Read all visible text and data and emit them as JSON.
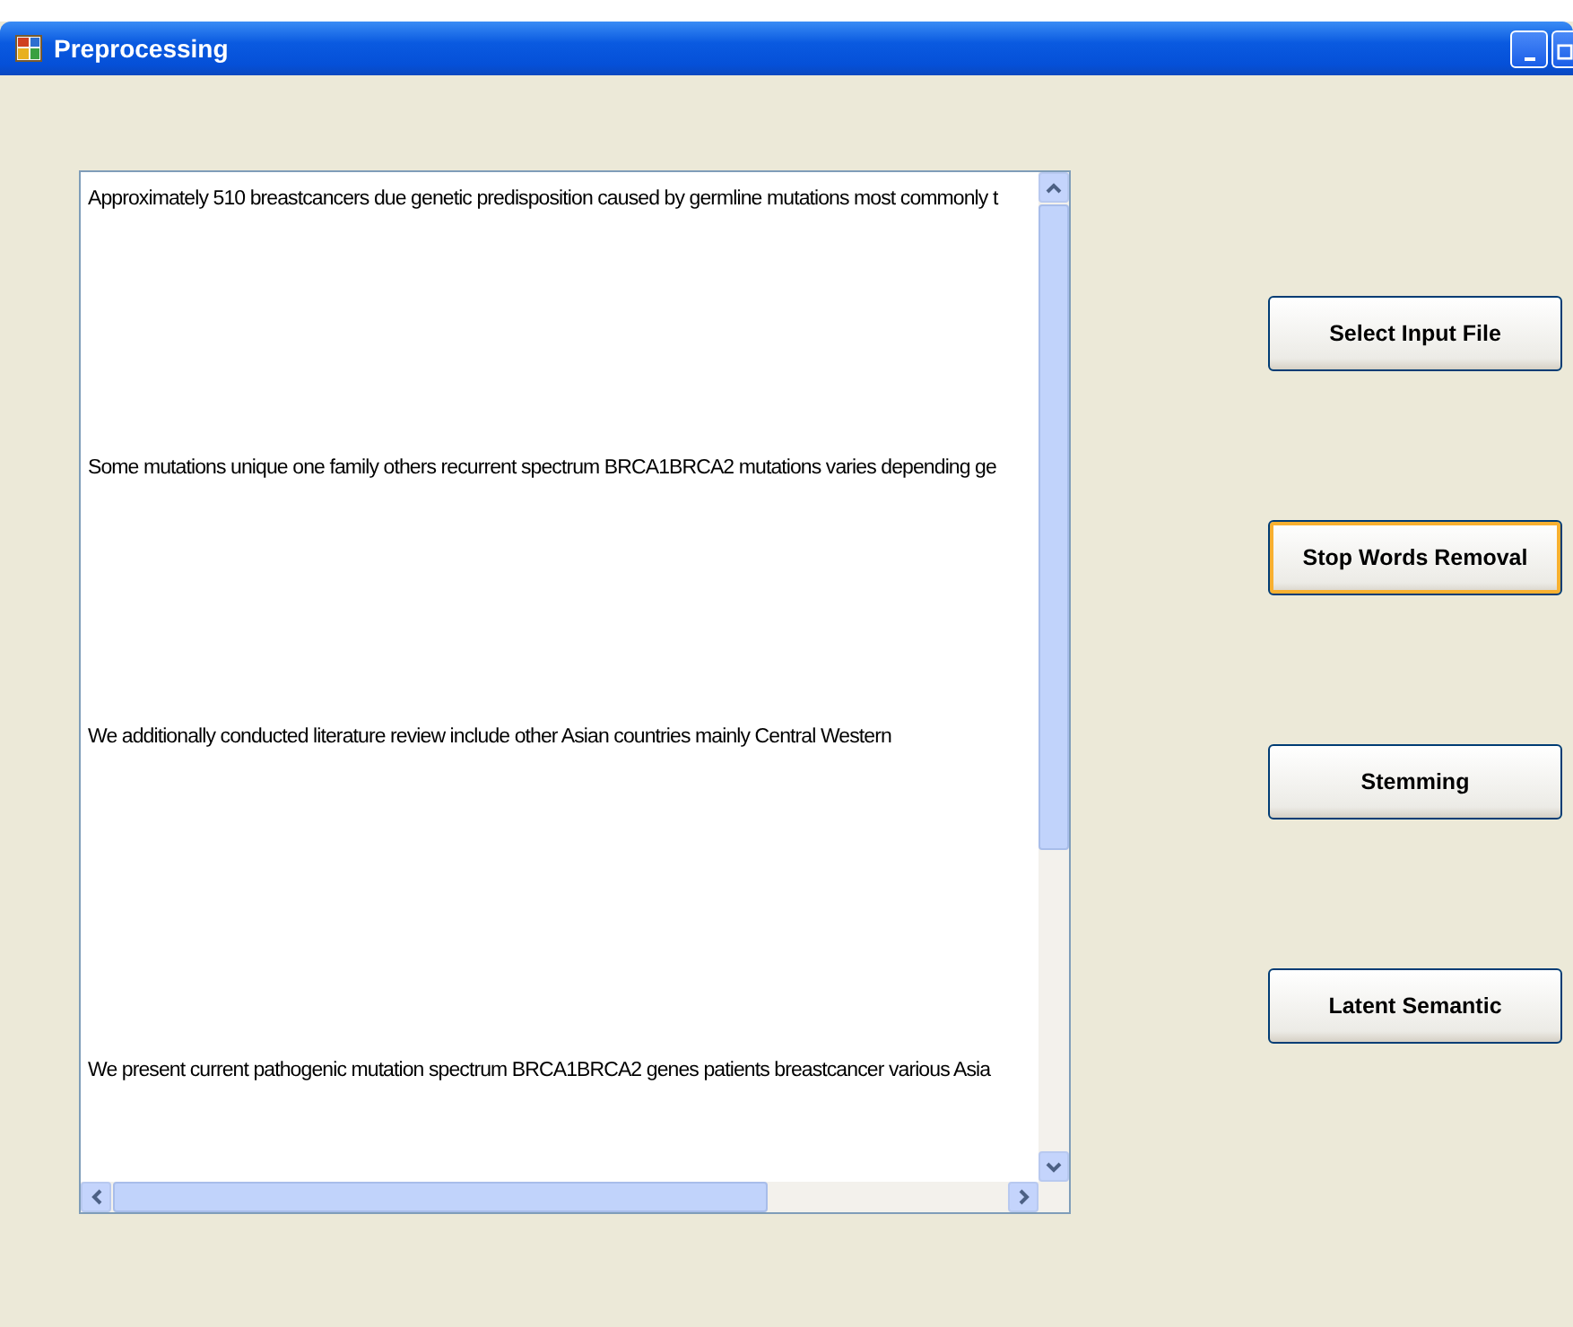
{
  "window": {
    "title": "Preprocessing"
  },
  "text_box": {
    "lines": [
      "Approximately 510 breastcancers due genetic predisposition caused by germline mutations most commonly t",
      "Some mutations unique one family others recurrent spectrum BRCA1BRCA2 mutations varies depending ge",
      "We additionally conducted literature review include other Asian countries mainly Central Western",
      "We present current pathogenic mutation spectrum BRCA1BRCA2 genes patients breastcancer various Asia"
    ]
  },
  "buttons": [
    {
      "label": "Select Input File",
      "focused": false
    },
    {
      "label": "Stop Words Removal",
      "focused": true
    },
    {
      "label": "Stemming",
      "focused": false
    },
    {
      "label": "Latent Semantic",
      "focused": false
    }
  ]
}
